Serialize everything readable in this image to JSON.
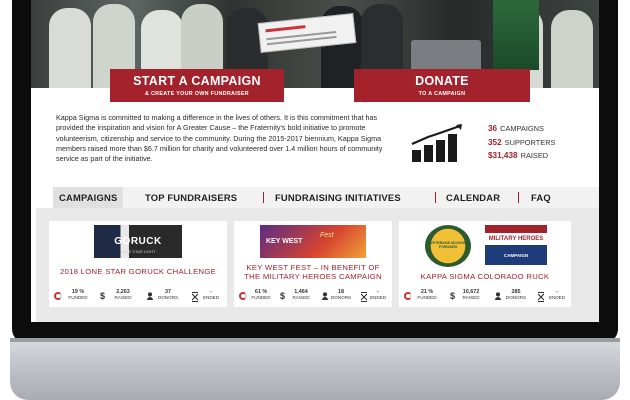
{
  "hero": {
    "start_campaign": {
      "label": "START A CAMPAIGN",
      "sub": "& CREATE YOUR OWN FUNDRAISER"
    },
    "donate": {
      "label": "DONATE",
      "sub": "TO A CAMPAIGN"
    }
  },
  "about": {
    "text": "Kappa Sigma is committed to making a difference in the lives of others. It is this commitment that has provided the inspiration and vision for A Greater Cause – the Fraternity's bold initiative to promote volunteerism, citizenship and service to the community. During the 2015-2017 biennium, Kappa Sigma members raised more than $6.7 million for charity and volunteered over 1.4 million hours of community service as part of the initiative."
  },
  "stats": [
    {
      "value": "36",
      "label": "CAMPAIGNS"
    },
    {
      "value": "352",
      "label": "SUPPORTERS"
    },
    {
      "value": "$31,438",
      "label": "RAISED"
    }
  ],
  "tabs": [
    "CAMPAIGNS",
    "TOP FUNDRAISERS",
    "FUNDRAISING INITIATIVES",
    "CALENDAR",
    "FAQ"
  ],
  "cards": [
    {
      "title": "2018 LONE STAR GORUCK CHALLENGE",
      "image_text": "GORUCK",
      "image_sub": "LONE STAR LIGHT",
      "funded": "19 %",
      "funded_label": "FUNDED",
      "raised": "2,263",
      "raised_label": "RAISED",
      "donors": "37",
      "donors_label": "DONORS",
      "ended": "-",
      "ended_label": "ENDED"
    },
    {
      "title": "KEY WEST FEST – IN BENEFIT OF THE MILITARY HEROES CAMPAIGN",
      "image_text": "KEY WEST",
      "image_sub": "Fest",
      "funded": "61 %",
      "funded_label": "FUNDED",
      "raised": "1,464",
      "raised_label": "RAISED",
      "donors": "18",
      "donors_label": "DONORS",
      "ended": "-",
      "ended_label": "ENDED"
    },
    {
      "title": "KAPPA SIGMA COLORADO RUCK",
      "image_text": "MILITARY HEROES",
      "image_sub": "CAMPAIGN",
      "image_badge": "VETERANS MOVING FORWARD",
      "funded": "21 %",
      "funded_label": "FUNDED",
      "raised": "10,672",
      "raised_label": "RAISED",
      "donors": "285",
      "donors_label": "DONORS",
      "ended": "-",
      "ended_label": "ENDED"
    }
  ],
  "colors": {
    "brand": "#a3222b",
    "tab_bar": "#f2f2f2",
    "panel": "#e9e9e9"
  }
}
